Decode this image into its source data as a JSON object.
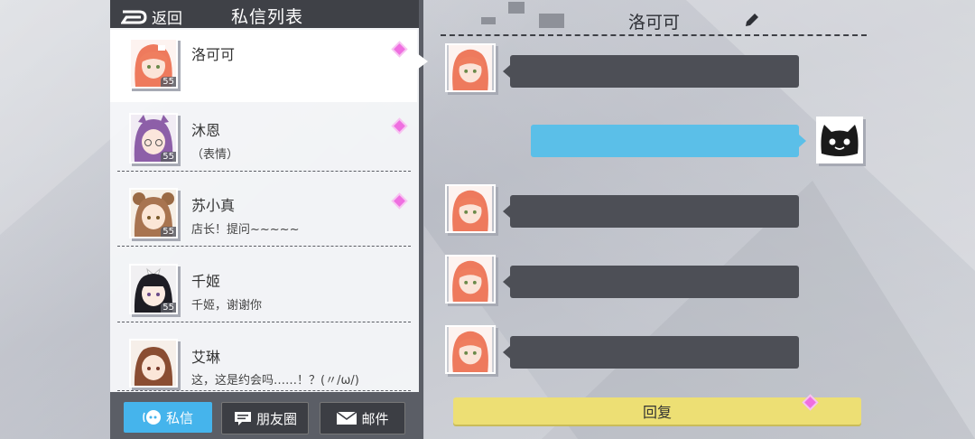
{
  "header": {
    "back_label": "返回",
    "title": "私信列表"
  },
  "conversations": [
    {
      "name": "洛可可",
      "message": "",
      "level": "55"
    },
    {
      "name": "沐恩",
      "message": "（表情）",
      "level": "55"
    },
    {
      "name": "苏小真",
      "message": "店长！提问~~~~~",
      "level": "55"
    },
    {
      "name": "千姬",
      "message": "千姬，谢谢你",
      "level": "55"
    },
    {
      "name": "艾琳",
      "message": "这，这是约会吗……！？(〃/ω/)",
      "level": ""
    }
  ],
  "tabs": {
    "messages": "私信",
    "moments": "朋友圈",
    "mail": "邮件"
  },
  "chat": {
    "title": "洛可可",
    "reply_label": "回复"
  },
  "colors": {
    "accent_blue": "#5bbfe8",
    "reply_yellow": "#eddf74",
    "gem_pink": "#ef6fe0",
    "dark_bar": "#3f4147"
  }
}
